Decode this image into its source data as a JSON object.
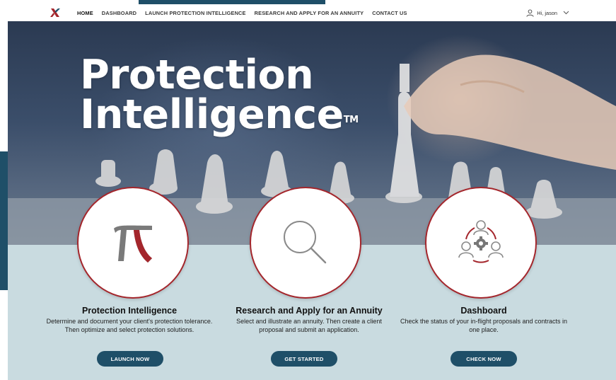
{
  "nav": {
    "links": [
      "HOME",
      "DASHBOARD",
      "LAUNCH PROTECTION INTELLIGENCE",
      "RESEARCH AND APPLY FOR AN ANNUITY",
      "CONTACT US"
    ],
    "user_greeting": "Hi, jason"
  },
  "hero": {
    "title_line1": "Protection",
    "title_line2": "Intelligence",
    "trademark": "TM"
  },
  "cards": [
    {
      "title": "Protection Intelligence",
      "description": "Determine and document your client's protection tolerance. Then optimize and select protection solutions.",
      "button": "LAUNCH NOW",
      "icon": "pi-icon"
    },
    {
      "title": "Research and Apply for an Annuity",
      "description": "Select and illustrate an annuity. Then create a client proposal and submit an application.",
      "button": "GET STARTED",
      "icon": "magnifier-icon"
    },
    {
      "title": "Dashboard",
      "description": "Check the status of your in-flight proposals and contracts in one place.",
      "button": "CHECK NOW",
      "icon": "team-gear-icon"
    }
  ],
  "colors": {
    "accent_red": "#a4262c",
    "button_navy": "#1f4f68",
    "panel_bg": "#c9dbe0"
  }
}
